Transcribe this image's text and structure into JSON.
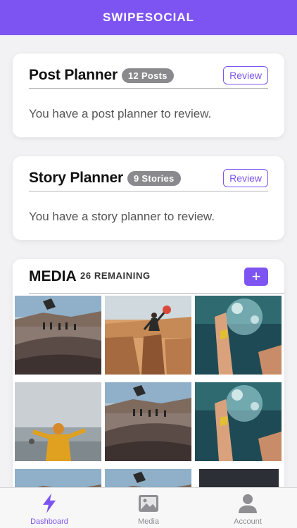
{
  "app": {
    "title": "SWIPESOCIAL"
  },
  "colors": {
    "accent": "#7d54f1",
    "badge": "#8a8a8e"
  },
  "post_planner": {
    "title": "Post Planner",
    "badge": "12 Posts",
    "review_label": "Review",
    "message": "You have a post planner to review."
  },
  "story_planner": {
    "title": "Story Planner",
    "badge": "9 Stories",
    "review_label": "Review",
    "message": "You have a story planner to review."
  },
  "media": {
    "title": "MEDIA",
    "remaining": "26 REMAINING",
    "add_label": "+",
    "thumbnails": [
      "skatepark",
      "desert-rock-climber",
      "underwater-dive",
      "snow-person-yellow-coat",
      "skatepark",
      "underwater-dive",
      "skatepark",
      "skatepark",
      "dark-placeholder"
    ]
  },
  "tabs": [
    {
      "label": "Dashboard",
      "icon": "lightning-icon",
      "active": true
    },
    {
      "label": "Media",
      "icon": "photo-icon",
      "active": false
    },
    {
      "label": "Account",
      "icon": "person-icon",
      "active": false
    }
  ]
}
